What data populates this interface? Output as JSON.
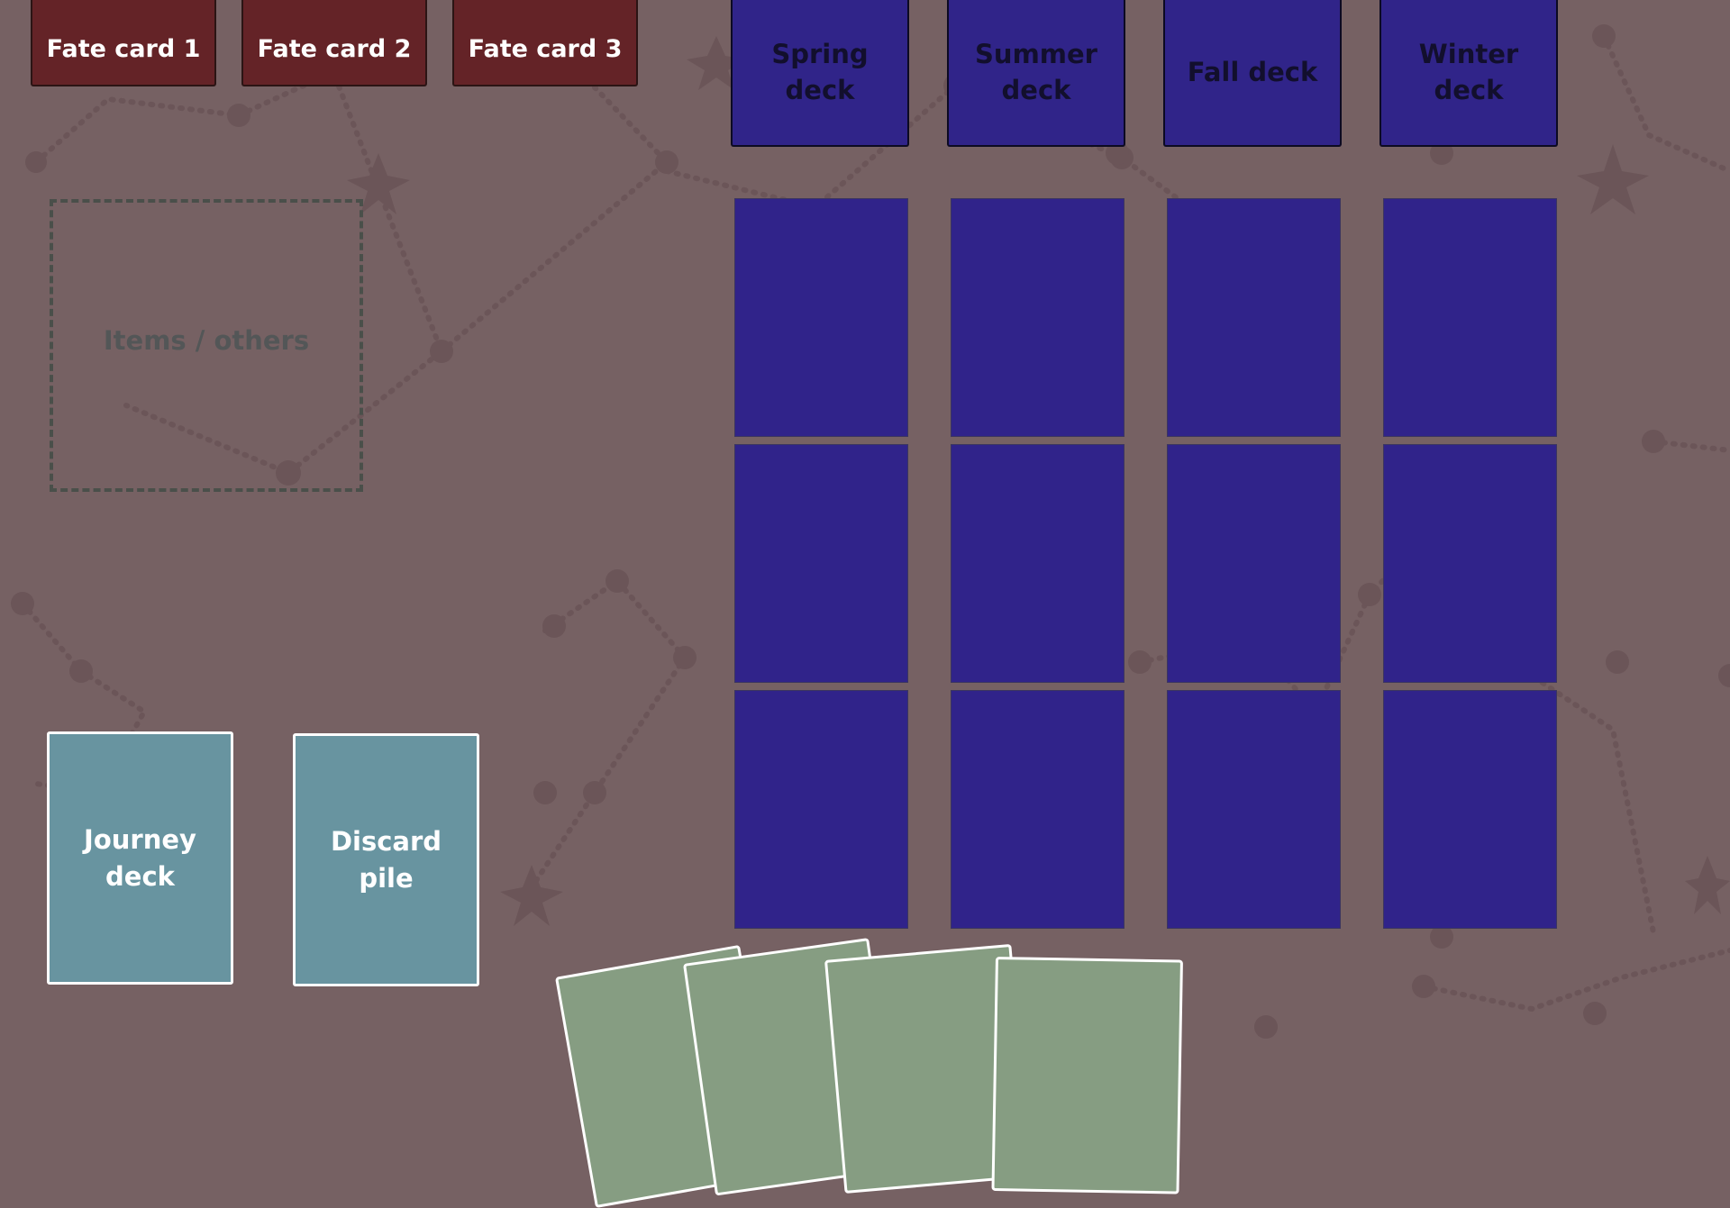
{
  "fate_cards": [
    "Fate card 1",
    "Fate card 2",
    "Fate card 3"
  ],
  "season_decks": [
    "Spring deck",
    "Summer deck",
    "Fall deck",
    "Winter deck"
  ],
  "items_zone": {
    "label": "Items / others"
  },
  "journey_deck": {
    "label": "Journey deck"
  },
  "discard_pile": {
    "label": "Discard pile"
  },
  "grid": {
    "columns": 4,
    "rows": 3
  },
  "hand": {
    "card_count": 4
  },
  "colors": {
    "background": "#766163",
    "fate_card": "#642327",
    "season_card": "#302489",
    "slot": "#30238a",
    "deck_card": "#6894a0",
    "hand_card": "#869d82",
    "constellation": "#6b5558"
  }
}
